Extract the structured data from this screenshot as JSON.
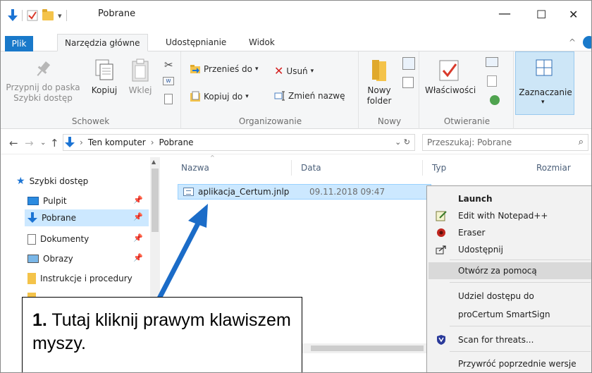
{
  "window": {
    "title": "Pobrane",
    "controls": {
      "minimize": "—",
      "maximize": "☐",
      "close": "✕"
    }
  },
  "ribbon": {
    "tabs": [
      "Plik",
      "Narzędzia główne",
      "Udostępnianie",
      "Widok"
    ],
    "active_tab": "Narzędzia główne",
    "groups": {
      "schowek": {
        "label": "Schowek",
        "pin": "Przypnij do paska\nSzybki dostęp",
        "pin_l1": "Przypnij do paska",
        "pin_l2": "Szybki dostęp",
        "copy": "Kopiuj",
        "paste": "Wklej"
      },
      "organizowanie": {
        "label": "Organizowanie",
        "move": "Przenieś do",
        "copy_to": "Kopiuj do",
        "delete": "Usuń",
        "rename": "Zmień nazwę"
      },
      "nowy": {
        "label": "Nowy",
        "new_folder_l1": "Nowy",
        "new_folder_l2": "folder"
      },
      "otwieranie": {
        "label": "Otwieranie",
        "properties": "Właściwości"
      },
      "zaznaczanie": {
        "label": "Zaznaczanie"
      }
    }
  },
  "address": {
    "crumbs": [
      "Ten komputer",
      "Pobrane"
    ],
    "search_placeholder": "Przeszukaj: Pobrane"
  },
  "nav": {
    "items": [
      {
        "label": "Szybki dostęp",
        "icon": "star-icon"
      },
      {
        "label": "Pulpit",
        "icon": "desktop-icon",
        "pinned": true
      },
      {
        "label": "Pobrane",
        "icon": "download-icon",
        "pinned": true,
        "selected": true
      },
      {
        "label": "Dokumenty",
        "icon": "document-icon",
        "pinned": true
      },
      {
        "label": "Obrazy",
        "icon": "image-icon",
        "pinned": true
      },
      {
        "label": "Instrukcje i procedury",
        "icon": "folder-icon"
      }
    ]
  },
  "list": {
    "columns": [
      "Nazwa",
      "Data",
      "Typ",
      "Rozmiar"
    ],
    "files": [
      {
        "name": "aplikacja_Certum.jnlp",
        "date": "09.11.2018 09:47"
      }
    ]
  },
  "context_menu": {
    "items": [
      {
        "label": "Launch",
        "bold": true
      },
      {
        "label": "Edit with Notepad++",
        "icon": "notepad-icon"
      },
      {
        "label": "Eraser",
        "icon": "eraser-icon"
      },
      {
        "label": "Udostępnij",
        "icon": "share-icon"
      },
      {
        "label": "Otwórz za pomocą",
        "hover": true
      },
      {
        "label": "Udziel dostępu do"
      },
      {
        "label": "proCertum SmartSign"
      },
      {
        "label": "Scan for threats...",
        "icon": "shield-icon"
      },
      {
        "label": "Przywróć poprzednie wersje"
      }
    ]
  },
  "annotation": {
    "step": "1.",
    "text": "Tutaj kliknij prawym klawiszem myszy."
  },
  "colors": {
    "accent": "#1979ca",
    "selection": "#cce8ff",
    "arrow": "#1b6cc8"
  }
}
